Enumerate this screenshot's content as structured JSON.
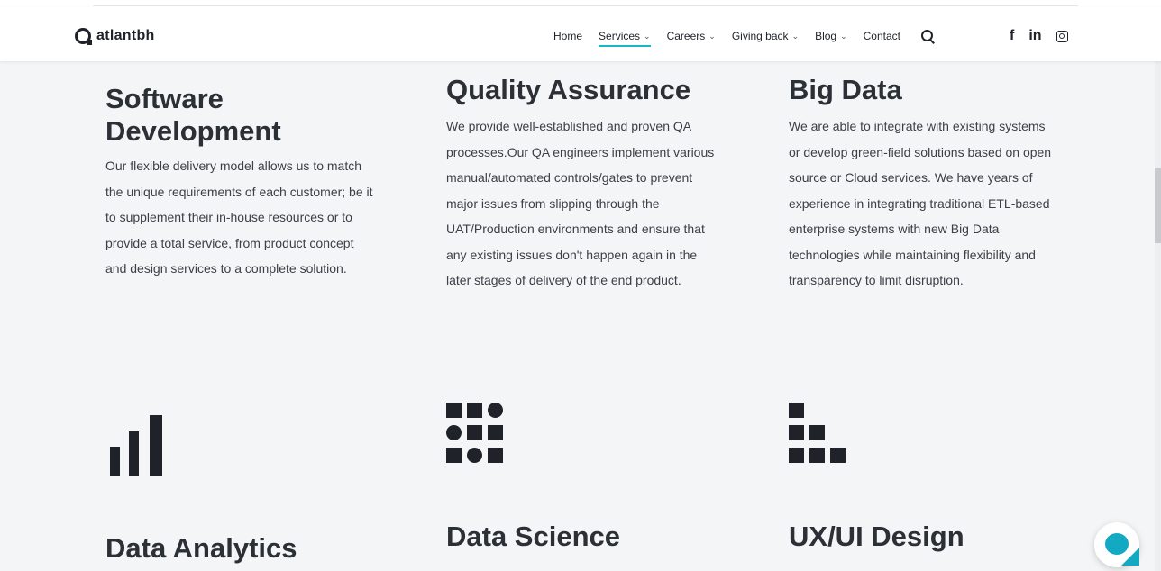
{
  "header": {
    "logo_text": "atlantbh",
    "nav": [
      {
        "label": "Home",
        "has_dropdown": false,
        "active": false
      },
      {
        "label": "Services",
        "has_dropdown": true,
        "active": true
      },
      {
        "label": "Careers",
        "has_dropdown": true,
        "active": false
      },
      {
        "label": "Giving back",
        "has_dropdown": true,
        "active": false
      },
      {
        "label": "Blog",
        "has_dropdown": true,
        "active": false
      },
      {
        "label": "Contact",
        "has_dropdown": false,
        "active": false
      }
    ],
    "chevron": "⌄",
    "social": {
      "facebook": "f",
      "linkedin": "in"
    },
    "accent_color": "#14b8c7"
  },
  "services": {
    "software": {
      "title": "Software Development",
      "body": "Our flexible delivery model allows us to match the unique requirements of each customer; be it to supplement their in-house resources or to provide a total service, from product concept and design services to a complete solution."
    },
    "qa": {
      "title": "Quality Assurance",
      "body": "We provide well-established and proven QA processes.Our QA engineers implement various manual/automated controls/gates to prevent major issues from slipping through the UAT/Production environments and ensure that any existing issues don't happen again in the later stages of delivery of the end product."
    },
    "bigdata": {
      "title": "Big Data",
      "body": "We are able to integrate with existing systems or develop green-field solutions based on open source or Cloud services. We have years of experience in integrating traditional ETL-based enterprise systems with new Big Data technologies while maintaining flexibility and transparency to limit disruption."
    },
    "analytics": {
      "title": "Data Analytics",
      "icon": "bar-chart-icon"
    },
    "science": {
      "title": "Data Science",
      "icon": "grid-shapes-icon"
    },
    "ux": {
      "title": "UX/UI Design",
      "icon": "stair-blocks-icon"
    }
  },
  "chat": {
    "color": "#14a9c3",
    "icon": "chat-icon"
  }
}
